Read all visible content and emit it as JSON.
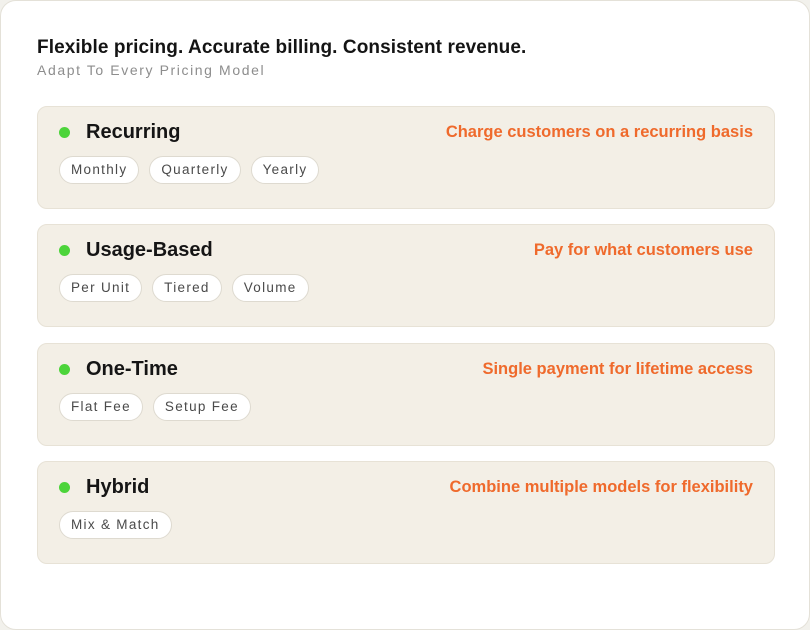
{
  "header": {
    "title": "Flexible pricing. Accurate billing. Consistent revenue.",
    "subtitle": "Adapt To Every Pricing Model"
  },
  "models": [
    {
      "name": "Recurring",
      "description": "Charge customers on a recurring basis",
      "tags": [
        "Monthly",
        "Quarterly",
        "Yearly"
      ]
    },
    {
      "name": "Usage-Based",
      "description": "Pay for what customers use",
      "tags": [
        "Per Unit",
        "Tiered",
        "Volume"
      ]
    },
    {
      "name": "One-Time",
      "description": "Single payment for lifetime access",
      "tags": [
        "Flat Fee",
        "Setup Fee"
      ]
    },
    {
      "name": "Hybrid",
      "description": "Combine multiple models for flexibility",
      "tags": [
        "Mix & Match"
      ]
    }
  ],
  "colors": {
    "accent": "#ef6a2c",
    "status_dot": "#4cd43a",
    "card_background": "#f3efe6"
  }
}
